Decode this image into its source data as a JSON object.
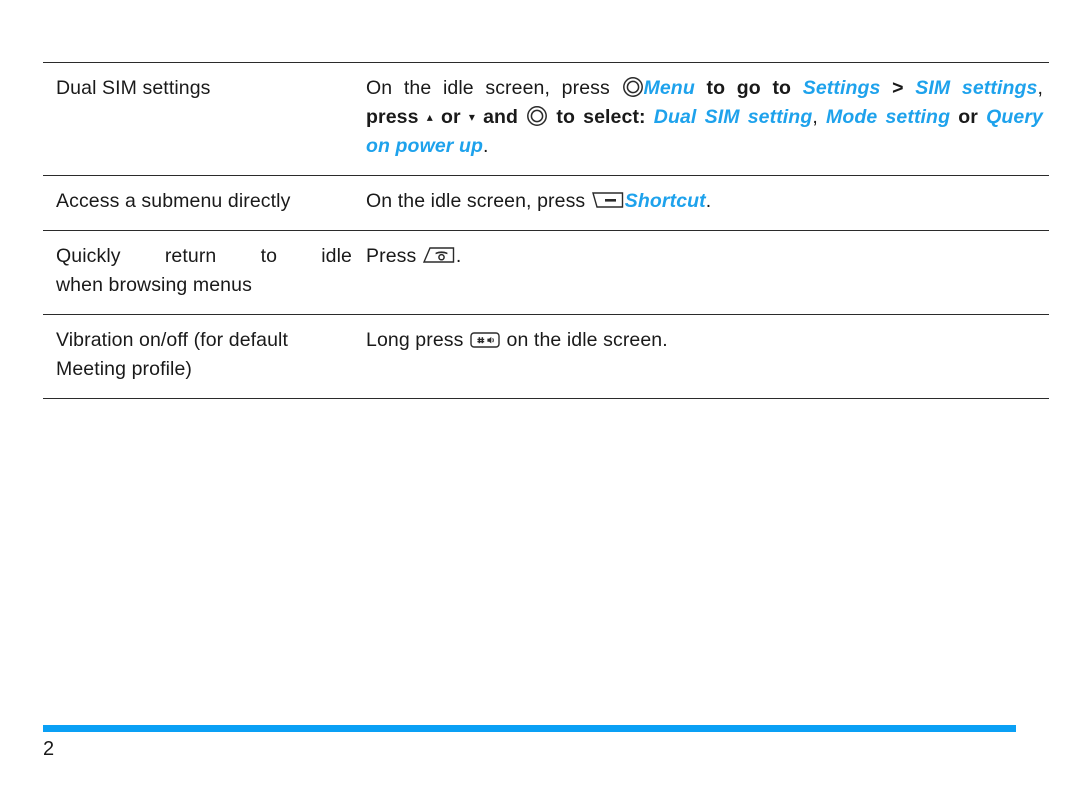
{
  "document": {
    "page_number": "2",
    "accent_color": "#0aa0f5",
    "link_color": "#1ea2ec"
  },
  "table": {
    "rows": [
      {
        "action": "Dual SIM settings",
        "howto": {
          "line1": {
            "seg1": "On  the  idle  screen,  press ",
            "icon": "center-select-key-icon",
            "menu": "Menu",
            "seg2": " to  go  to ",
            "settings": "Settings",
            "gt": " > ",
            "sim_settings": "SIM  settings",
            "seg3": ","
          },
          "line2": {
            "seg1": "press ",
            "up": "▴",
            "seg2": " or ",
            "down": "▾",
            "seg3": " and ",
            "icon": "center-select-key-icon",
            "seg4": " to select: ",
            "opt1": "Dual SIM setting",
            "sep1": ", ",
            "opt2": "Mode setting",
            "sep2": " or ",
            "opt3": "Query"
          },
          "line3": {
            "opt3_cont": "on power up",
            "period": "."
          }
        }
      },
      {
        "action": "Access a submenu directly",
        "howto": {
          "line1": {
            "seg1": "On the idle screen, press ",
            "icon": "left-softkey-icon",
            "shortcut": "Shortcut",
            "period": "."
          }
        }
      },
      {
        "action_lines": [
          "Quickly   return   to   idle",
          "when browsing menus"
        ],
        "howto": {
          "line1": {
            "seg1": "Press ",
            "icon": "end-call-key-icon",
            "period": "."
          }
        }
      },
      {
        "action_lines": [
          "Vibration on/off (for default",
          "Meeting profile)"
        ],
        "howto": {
          "line1": {
            "seg1": "Long press ",
            "icon": "hash-key-icon",
            "seg2": " on the idle screen."
          }
        }
      }
    ]
  }
}
